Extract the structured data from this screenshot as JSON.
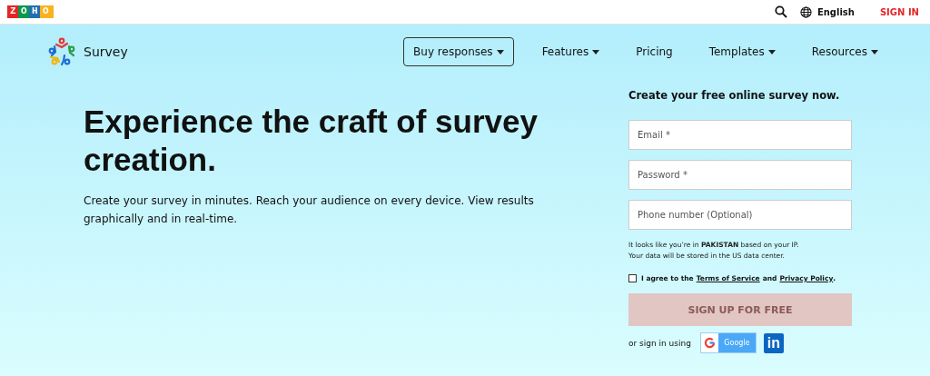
{
  "topbar": {
    "logo": "ZOHO",
    "language": "English",
    "sign_in": "SIGN IN"
  },
  "nav": {
    "brand": "Survey",
    "items": [
      {
        "label": "Buy responses",
        "dropdown": true,
        "outlined": true
      },
      {
        "label": "Features",
        "dropdown": true,
        "outlined": false
      },
      {
        "label": "Pricing",
        "dropdown": false,
        "outlined": false
      },
      {
        "label": "Templates",
        "dropdown": true,
        "outlined": false
      },
      {
        "label": "Resources",
        "dropdown": true,
        "outlined": false
      }
    ]
  },
  "hero": {
    "title": "Experience the craft of survey creation.",
    "subtitle": "Create your survey in minutes. Reach your audience on every device. View results graphically and in real-time."
  },
  "signup": {
    "heading": "Create your free online survey now.",
    "fields": [
      {
        "placeholder": "Email *"
      },
      {
        "placeholder": "Password *"
      },
      {
        "placeholder": "Phone number (Optional)"
      }
    ],
    "location_note": "It looks like you’re in **PAKISTAN** based on your IP.",
    "storage_note": "Your data will be stored in the US data center.",
    "agree": {
      "checked": false,
      "prefix": "I agree to the",
      "terms": "Terms of Service",
      "middle": "and",
      "privacy": "Privacy Policy",
      "suffix": "."
    },
    "button": {
      "label": "SIGN UP FOR FREE",
      "disabled": true
    },
    "alt_label": "or sign in using",
    "google": "Google",
    "linkedin": "in"
  }
}
